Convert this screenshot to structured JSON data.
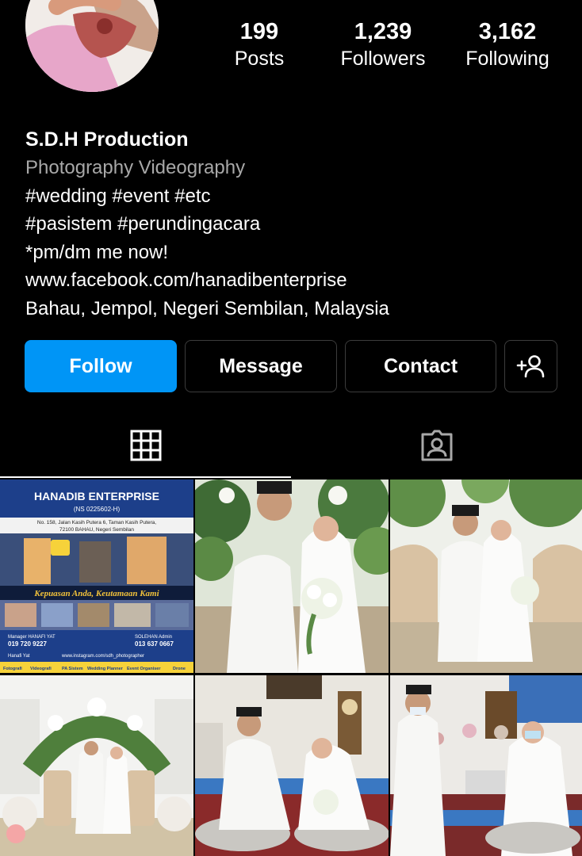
{
  "profile": {
    "name": "S.D.H Production",
    "category": "Photography Videography",
    "bio_lines": [
      "#wedding #event #etc",
      "#pasistem #perundingacara",
      "*pm/dm me now!"
    ],
    "link": "www.facebook.com/hanadibenterprise",
    "location": "Bahau, Jempol, Negeri Sembilan, Malaysia"
  },
  "stats": {
    "posts": {
      "value": "199",
      "label": "Posts"
    },
    "followers": {
      "value": "1,239",
      "label": "Followers"
    },
    "following": {
      "value": "3,162",
      "label": "Following"
    }
  },
  "actions": {
    "follow": "Follow",
    "message": "Message",
    "contact": "Contact"
  },
  "tabs": {
    "active": "grid",
    "items": [
      {
        "id": "grid",
        "icon": "grid-icon"
      },
      {
        "id": "tagged",
        "icon": "tagged-person-icon"
      }
    ]
  },
  "posts": {
    "poster": {
      "brand": "HANADIB ENTERPRISE",
      "reg": "(NS 0225602-H)",
      "address_1": "No. 158, Jalan Kasih Putera 6, Taman Kasih Putera,",
      "address_2": "72100 BAHAU, Negeri Sembilan",
      "tagline": "Kepuasan Anda, Keutamaan Kami",
      "manager_1": "Manager  HANAFI YAT",
      "phone_1": "019 720 9227",
      "manager_2": "SOLEHAN  Admin",
      "phone_2": "013 637 0667",
      "social_1": "Hanafi Yat",
      "social_2": "www.instagram.com/sdh_photographer",
      "services": [
        "Fotografi",
        "Videografi",
        "PA Sistem",
        "Wedding Planner",
        "Event Organiser",
        "Drone"
      ]
    }
  },
  "colors": {
    "follow_blue": "#0095f6",
    "background": "#000000",
    "muted_text": "#a8a8a8",
    "button_border": "#3c3c3c"
  }
}
